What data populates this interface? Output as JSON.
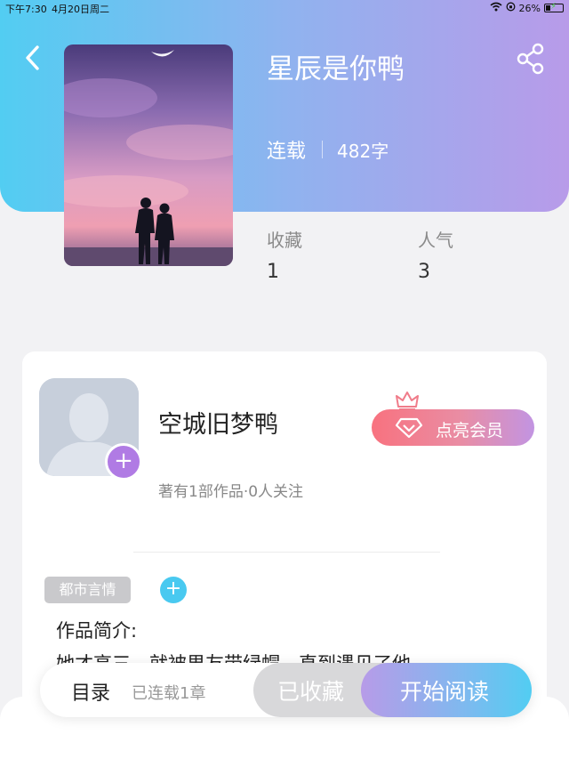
{
  "status_bar": {
    "time": "下午7:30",
    "date": "4月20日周二",
    "battery_text": "26%",
    "battery_level": 0.26
  },
  "book": {
    "title": "星辰是你鸭",
    "status": "连载",
    "word_count": "482字",
    "stats": [
      {
        "label": "收藏",
        "value": "1"
      },
      {
        "label": "人气",
        "value": "3"
      }
    ]
  },
  "author": {
    "name": "空城旧梦鸭",
    "stats": "著有1部作品·0人关注",
    "vip_label": "点亮会员"
  },
  "tag": {
    "label": "都市言情"
  },
  "intro": {
    "heading": "作品简介:",
    "text": "她才高三，就被男友带绿帽，直到遇见了他"
  },
  "bottom_bar": {
    "toc_label": "目录",
    "chapter_count": "已连载1章",
    "collected_label": "已收藏",
    "read_label": "开始阅读"
  },
  "icons": {
    "back": "chevron-left-icon",
    "share": "share-icon",
    "wifi": "wifi-icon",
    "battery": "battery-icon",
    "crown": "crown-icon",
    "diamond": "diamond-icon",
    "avatar_add": "plus-icon",
    "tag_add": "plus-icon"
  },
  "colors": {
    "header_gradient_start": "#52cdf2",
    "header_gradient_end": "#b89be9",
    "vip_gradient_start": "#f8727f",
    "vip_gradient_end": "#c294e2",
    "avatar_plus": "#b07be4",
    "tag_add": "#49c9f0",
    "tag_bg": "#c9c9cc"
  }
}
